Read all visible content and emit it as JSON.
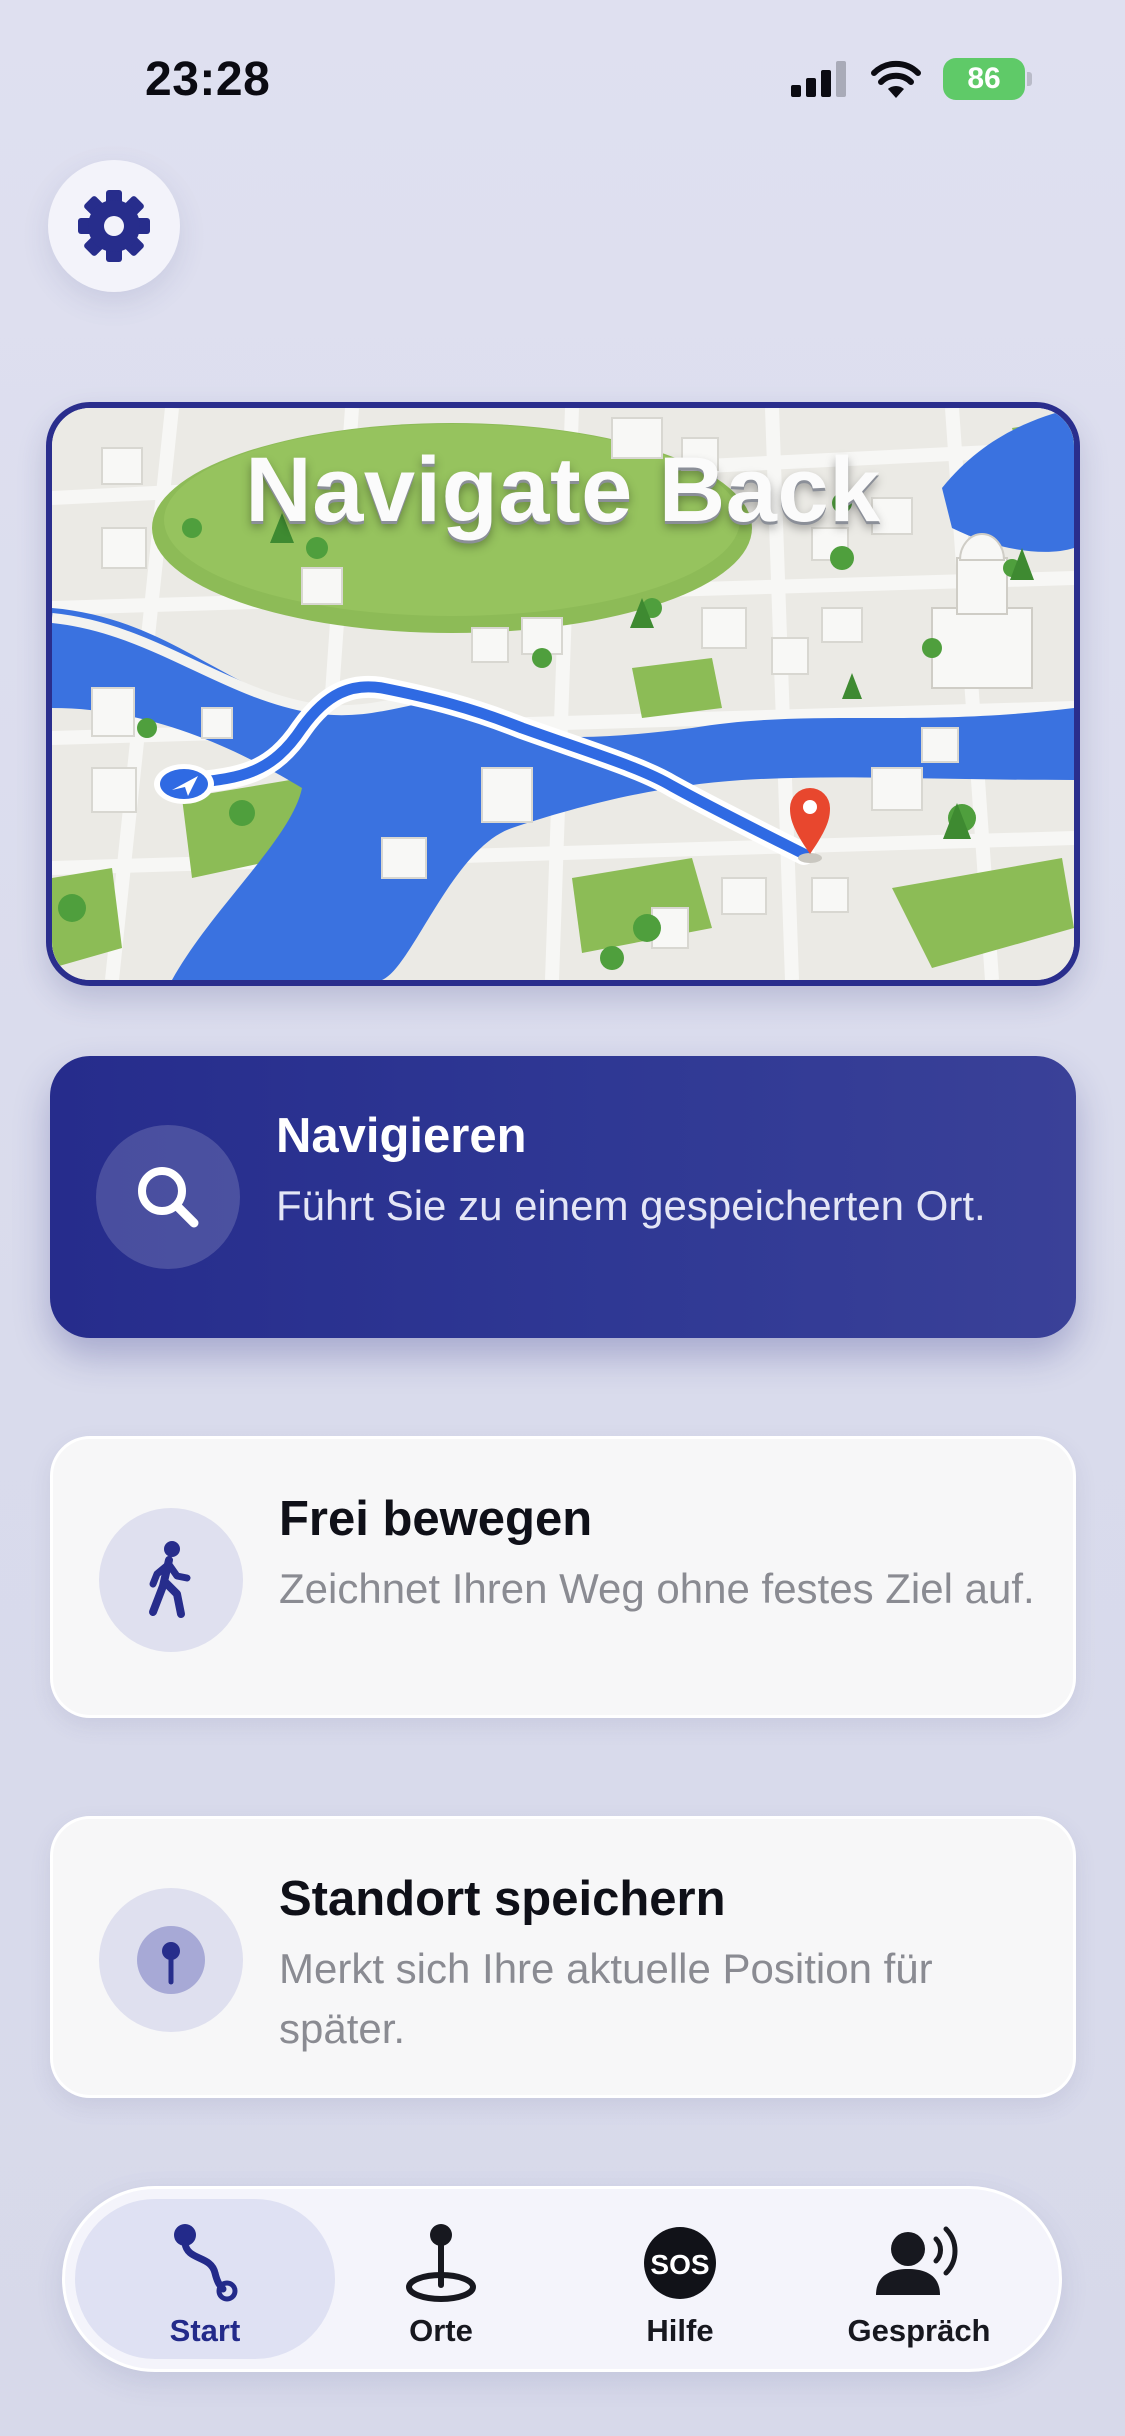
{
  "status_bar": {
    "time": "23:28",
    "battery": "86"
  },
  "hero": {
    "title": "Navigate Back"
  },
  "cards": [
    {
      "title": "Navigieren",
      "description": "Führt Sie zu einem gespeicherten Ort.",
      "icon": "search-icon"
    },
    {
      "title": "Frei bewegen",
      "description": "Zeichnet Ihren Weg ohne festes Ziel auf.",
      "icon": "walking-person-icon"
    },
    {
      "title": "Standort speichern",
      "description": "Merkt sich Ihre aktuelle Position für später.",
      "icon": "pin-icon"
    }
  ],
  "tabs": [
    {
      "label": "Start",
      "icon": "route-icon",
      "active": true
    },
    {
      "label": "Orte",
      "icon": "map-pin-icon",
      "active": false
    },
    {
      "label": "Hilfe",
      "icon": "sos-icon",
      "icon_text": "SOS",
      "active": false
    },
    {
      "label": "Gespräch",
      "icon": "speaking-person-icon",
      "active": false
    }
  ],
  "colors": {
    "primary": "#262c8c",
    "background": "#dcdeee",
    "battery": "#5fca68",
    "route": "#3b73e6",
    "destination_pin": "#e8472e"
  }
}
